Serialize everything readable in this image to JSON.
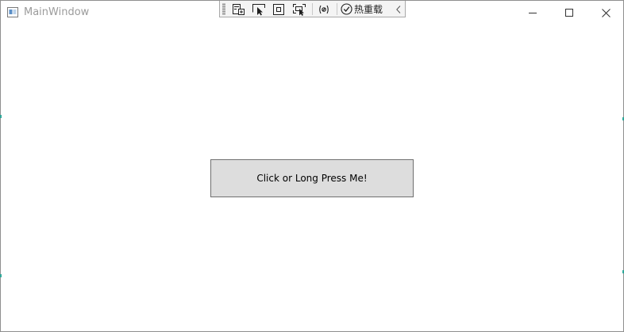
{
  "window": {
    "title": "MainWindow"
  },
  "debug_toolbar": {
    "hot_reload_label": "热重载",
    "icons": [
      "live-visual-tree-icon",
      "select-element-icon",
      "layout-adorner-icon",
      "track-focus-icon",
      "binding-failures-icon",
      "hot-reload-check-icon",
      "collapse-chevron-icon"
    ]
  },
  "main": {
    "button_label": "Click or Long Press Me!"
  },
  "colors": {
    "button_bg": "#dddddd",
    "button_border": "#707070",
    "title_text": "#9b9b9b",
    "toolbar_bg": "#f4f4f4"
  }
}
